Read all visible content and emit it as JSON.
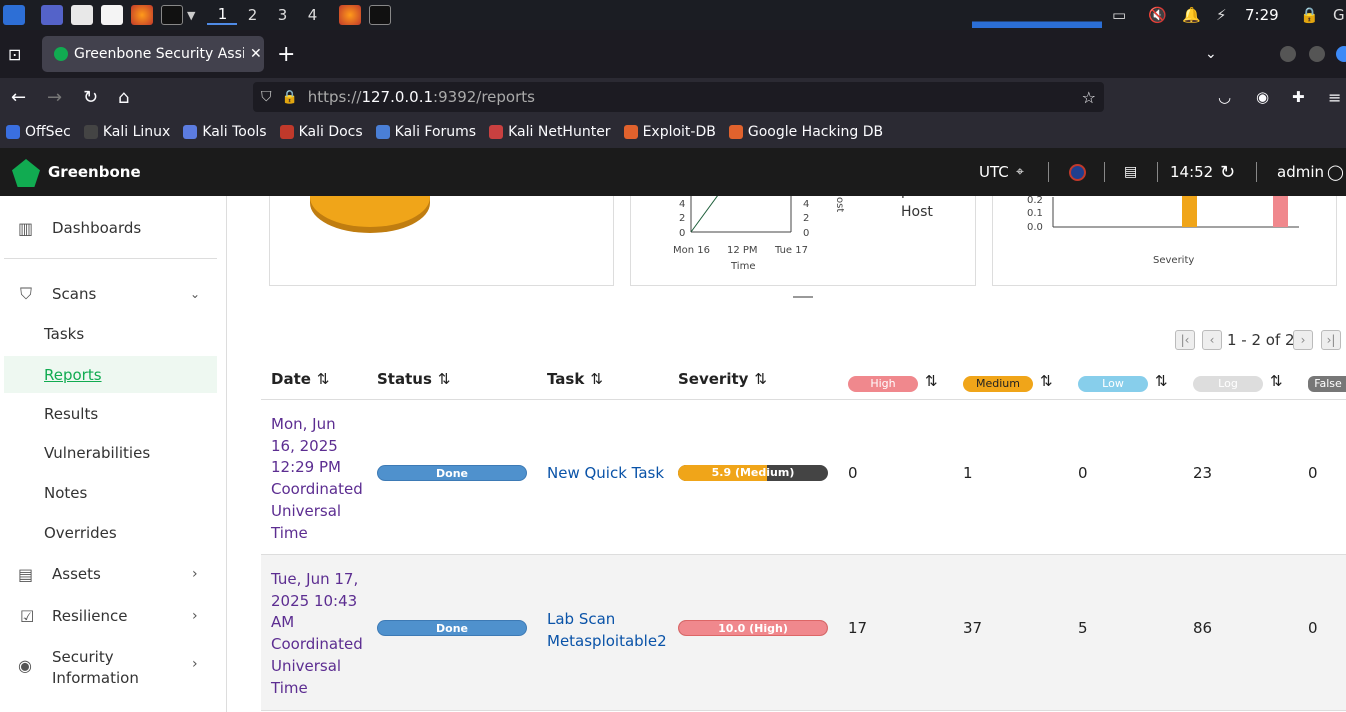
{
  "taskbar": {
    "workspaces": [
      "1",
      "2",
      "3",
      "4"
    ],
    "clock": "7:29"
  },
  "browser": {
    "tab_title": "Greenbone Security Assis",
    "url_prefix": "https://",
    "url_host": "127.0.0.1",
    "url_rest": ":9392/reports",
    "bookmarks": [
      "OffSec",
      "Kali Linux",
      "Kali Tools",
      "Kali Docs",
      "Kali Forums",
      "Kali NetHunter",
      "Exploit-DB",
      "Google Hacking DB"
    ]
  },
  "gsa_header": {
    "brand": "Greenbone",
    "timezone": "UTC",
    "time": "14:52",
    "user": "admin"
  },
  "sidebar": {
    "dashboards": "Dashboards",
    "scans": "Scans",
    "sub": [
      "Tasks",
      "Reports",
      "Results",
      "Vulnerabilities",
      "Notes",
      "Overrides"
    ],
    "assets": "Assets",
    "resilience": "Resilience",
    "security_info_1": "Security",
    "security_info_2": "Information"
  },
  "charts": {
    "line": {
      "y_ticks": [
        "4",
        "2",
        "0"
      ],
      "y2_ticks": [
        "4",
        "2",
        "0"
      ],
      "x_ticks": [
        "Mon 16",
        "12 PM",
        "Tue 17"
      ],
      "xlabel": "Time",
      "ylabel2": "ost",
      "legend_1": "per",
      "legend_2": "Host"
    },
    "bar": {
      "y_ticks": [
        "0.2",
        "0.1",
        "0.0"
      ],
      "xlabel": "Severity"
    }
  },
  "pagination": {
    "text": "1 - 2 of 2"
  },
  "table": {
    "headers": {
      "date": "Date",
      "status": "Status",
      "task": "Task",
      "severity": "Severity",
      "high": "High",
      "medium": "Medium",
      "low": "Low",
      "log": "Log",
      "false": "False"
    },
    "rows": [
      {
        "date_lines": [
          "Mon, Jun",
          "16, 2025",
          "12:29 PM",
          "Coordinated",
          "Universal",
          "Time"
        ],
        "status": "Done",
        "task_lines": [
          "New Quick Task"
        ],
        "severity": "5.9 (Medium)",
        "severity_value": 5.9,
        "high": "0",
        "medium": "1",
        "low": "0",
        "log": "23",
        "false_pos": "0"
      },
      {
        "date_lines": [
          "Tue, Jun 17,",
          "2025 10:43",
          "AM",
          "Coordinated",
          "Universal",
          "Time"
        ],
        "status": "Done",
        "task_lines": [
          "Lab Scan",
          "Metasploitable2"
        ],
        "severity": "10.0 (High)",
        "severity_value": 10.0,
        "high": "17",
        "medium": "37",
        "low": "5",
        "log": "86",
        "false_pos": "0"
      }
    ]
  },
  "colors": {
    "accent": "#11ab51",
    "link": "#0a53a8",
    "visited": "#5c2d91",
    "done": "#4f91cd",
    "high": "#f0888d",
    "medium": "#f0a519",
    "low": "#87ceeb",
    "log": "#dddddd"
  }
}
